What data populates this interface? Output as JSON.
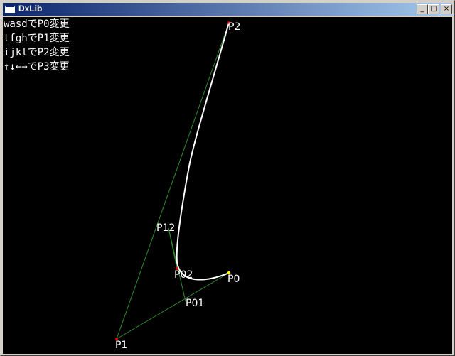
{
  "window": {
    "title": "DxLib",
    "minimize_glyph": "_",
    "maximize_glyph": "□",
    "close_glyph": "×"
  },
  "help_lines": [
    "wasdでP0変更",
    "tfghでP1変更",
    "ijklでP2変更",
    "↑↓←→でP3変更"
  ],
  "points": {
    "P0": "P0",
    "P1": "P1",
    "P2": "P2",
    "P01": "P01",
    "P12": "P12",
    "P02": "P02"
  },
  "colors": {
    "background": "#000000",
    "curve": "#ffffff",
    "guide": "#2e8b2e",
    "control_point": "#ff0000",
    "endpoint": "#ffff00"
  }
}
